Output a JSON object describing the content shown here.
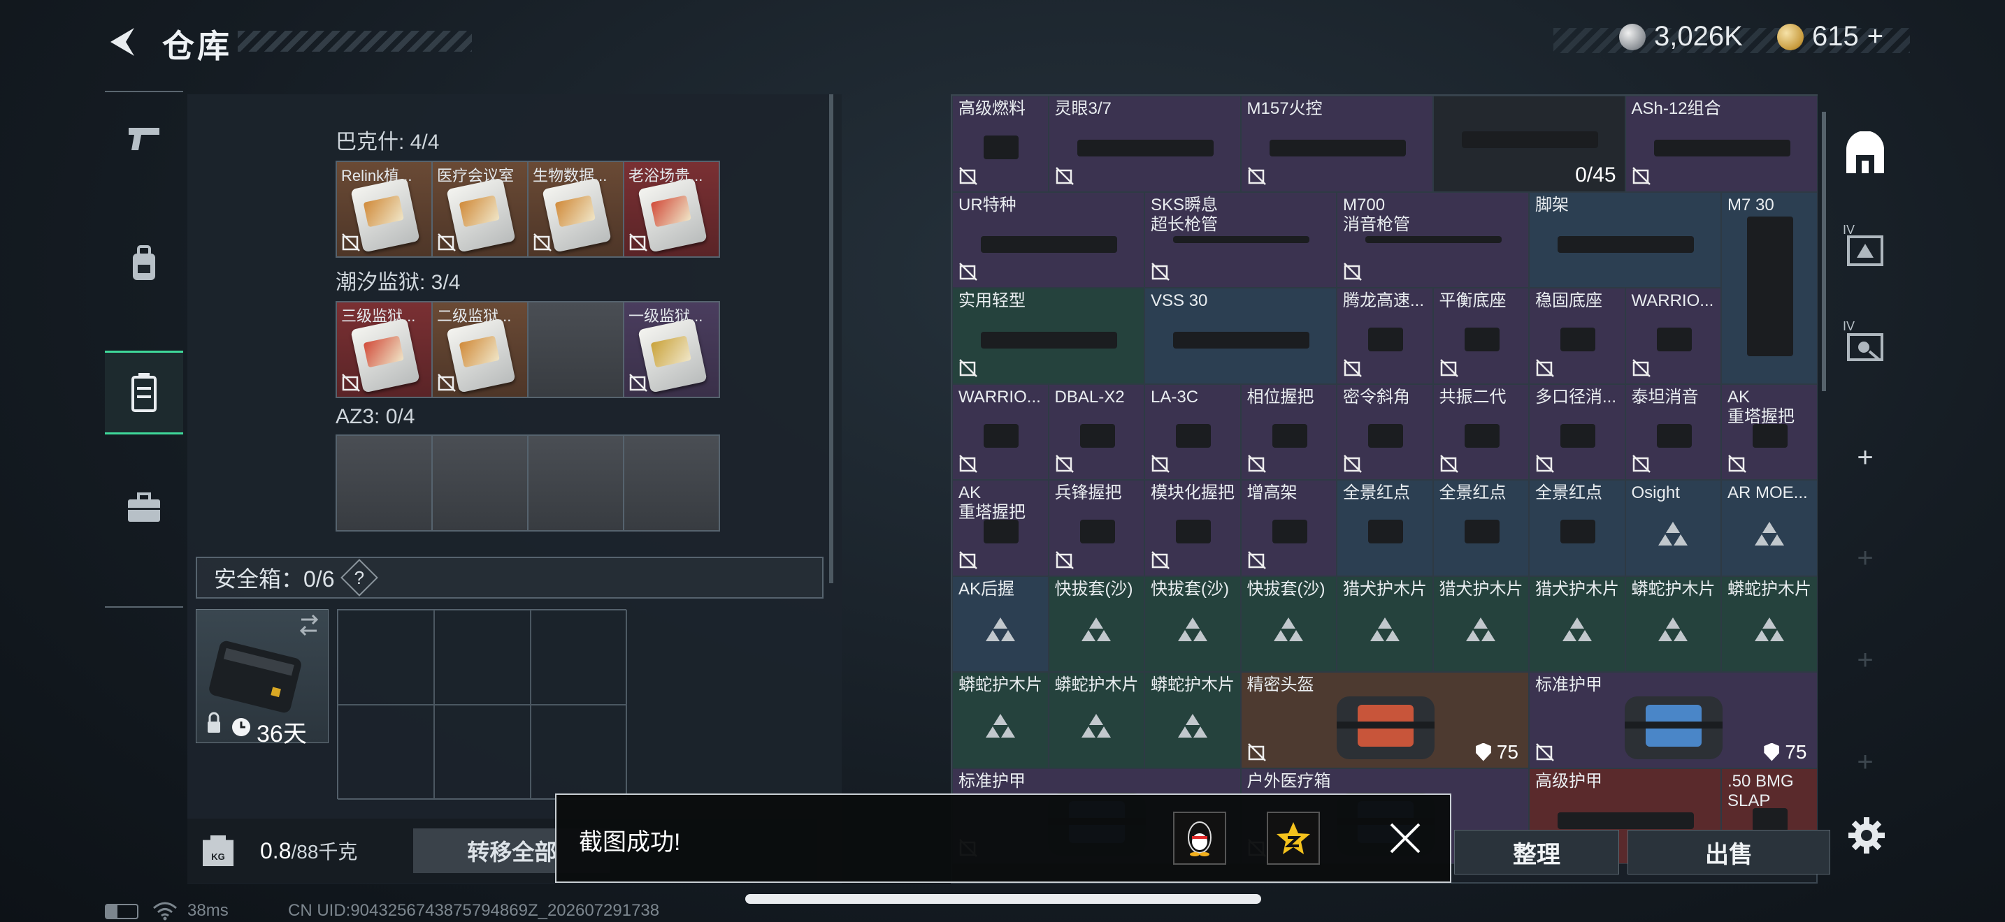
{
  "header": {
    "title": "仓库"
  },
  "currency": {
    "silver": "3,026K",
    "gold": "615",
    "gold_add": "+"
  },
  "left_nav": [
    "pistol-icon",
    "backpack-icon",
    "storage-icon",
    "briefcase-icon"
  ],
  "collections": [
    {
      "label": "巴克什: 4/4",
      "cells": [
        {
          "name": "Relink植...",
          "bg": "brown"
        },
        {
          "name": "医疗会议室",
          "bg": "brown"
        },
        {
          "name": "生物数据...",
          "bg": "brown"
        },
        {
          "name": "老浴场贵...",
          "bg": "red"
        }
      ]
    },
    {
      "label": "潮汐监狱: 3/4",
      "cells": [
        {
          "name": "三级监狱...",
          "bg": "red"
        },
        {
          "name": "二级监狱...",
          "bg": "brown"
        },
        {
          "name": "",
          "bg": "grey"
        },
        {
          "name": "一级监狱...",
          "bg": "purple"
        }
      ]
    },
    {
      "label": "AZ3: 0/4",
      "cells": [
        {
          "name": "",
          "bg": "grey"
        },
        {
          "name": "",
          "bg": "grey"
        },
        {
          "name": "",
          "bg": "grey"
        },
        {
          "name": "",
          "bg": "grey"
        }
      ]
    }
  ],
  "safe_box": {
    "label": "安全箱：0/6",
    "help": "?",
    "days": "36天"
  },
  "weight": {
    "value": "0.8",
    "max": "/88千克",
    "kg": "KG"
  },
  "transfer_all": "转移全部",
  "warehouse_items": [
    {
      "name": "高级燃料",
      "bg": "c-purple"
    },
    {
      "name": "灵眼3/7",
      "bg": "c-purple",
      "span": 2
    },
    {
      "name": "M157火控",
      "bg": "c-purple",
      "span": 2
    },
    {
      "name": "",
      "bg": "c-dark",
      "count": "0/45",
      "span": 2
    },
    {
      "name": "ASh-12组合",
      "bg": "c-purple",
      "span": 2
    },
    {
      "name": "UR特种",
      "bg": "c-purple",
      "span": 2
    },
    {
      "name": "SKS瞬息\n超长枪管",
      "bg": "c-purple",
      "span": 2
    },
    {
      "name": "M700\n消音枪管",
      "bg": "c-purple",
      "span": 2
    },
    {
      "name": "脚架",
      "bg": "c-blue",
      "span": 2
    },
    {
      "name": "M7 30",
      "bg": "c-blue",
      "tall": true
    },
    {
      "name": "实用轻型",
      "bg": "c-teal",
      "span": 2
    },
    {
      "name": "VSS 30",
      "bg": "c-blue",
      "span": 2
    },
    {
      "name": "腾龙高速...",
      "bg": "c-purple"
    },
    {
      "name": "平衡底座",
      "bg": "c-purple"
    },
    {
      "name": "稳固底座",
      "bg": "c-purple"
    },
    {
      "name": "WARRIO...",
      "bg": "c-purple"
    },
    {
      "name": "WARRIO...",
      "bg": "c-purple"
    },
    {
      "name": "DBAL-X2",
      "bg": "c-purple"
    },
    {
      "name": "LA-3C",
      "bg": "c-purple"
    },
    {
      "name": "相位握把",
      "bg": "c-purple"
    },
    {
      "name": "密令斜角",
      "bg": "c-purple"
    },
    {
      "name": "共振二代",
      "bg": "c-purple"
    },
    {
      "name": "多口径消...",
      "bg": "c-purple"
    },
    {
      "name": "泰坦消音",
      "bg": "c-purple"
    },
    {
      "name": "AK\n重塔握把",
      "bg": "c-purple"
    },
    {
      "name": "AK\n重塔握把",
      "bg": "c-purple"
    },
    {
      "name": "兵锋握把",
      "bg": "c-purple"
    },
    {
      "name": "模块化握把",
      "bg": "c-purple"
    },
    {
      "name": "增高架",
      "bg": "c-purple"
    },
    {
      "name": "全景红点",
      "bg": "c-blue"
    },
    {
      "name": "全景红点",
      "bg": "c-blue"
    },
    {
      "name": "全景红点",
      "bg": "c-blue"
    },
    {
      "name": "Osight",
      "bg": "c-blue"
    },
    {
      "name": "AR MOE...",
      "bg": "c-blue"
    },
    {
      "name": "AK后握",
      "bg": "c-blue"
    },
    {
      "name": "快拔套(沙)",
      "bg": "c-teal"
    },
    {
      "name": "快拔套(沙)",
      "bg": "c-teal"
    },
    {
      "name": "快拔套(沙)",
      "bg": "c-teal"
    },
    {
      "name": "猎犬护木片",
      "bg": "c-teal"
    },
    {
      "name": "猎犬护木片",
      "bg": "c-teal"
    },
    {
      "name": "猎犬护木片",
      "bg": "c-teal"
    },
    {
      "name": "蟒蛇护木片",
      "bg": "c-teal"
    },
    {
      "name": "蟒蛇护木片",
      "bg": "c-teal"
    },
    {
      "name": "蟒蛇护木片",
      "bg": "c-teal"
    },
    {
      "name": "蟒蛇护木片",
      "bg": "c-teal"
    },
    {
      "name": "蟒蛇护木片",
      "bg": "c-teal"
    },
    {
      "name": "精密头盔",
      "bg": "c-brown",
      "span": 3,
      "dur": "75"
    },
    {
      "name": "标准护甲",
      "bg": "c-purple",
      "span": 3,
      "dur": "75"
    },
    {
      "name": "标准护甲",
      "bg": "c-purple",
      "span": 3
    },
    {
      "name": "户外医疗箱",
      "bg": "c-purple",
      "span": 3
    },
    {
      "name": "高级护甲",
      "bg": "c-red",
      "span": 2
    },
    {
      "name": ".50 BMG\nSLAP",
      "bg": "c-red"
    }
  ],
  "right_nav": {
    "level_a": "IV",
    "level_b": "IV",
    "plus": "+"
  },
  "buttons": {
    "sort": "整理",
    "sell": "出售"
  },
  "toast": {
    "message": "截图成功!"
  },
  "status_bar": {
    "ping": "38ms",
    "uid": "CN UID:9043256743875794869Z_202607291738"
  },
  "colors": {
    "accent_green": "#3fd89a"
  }
}
